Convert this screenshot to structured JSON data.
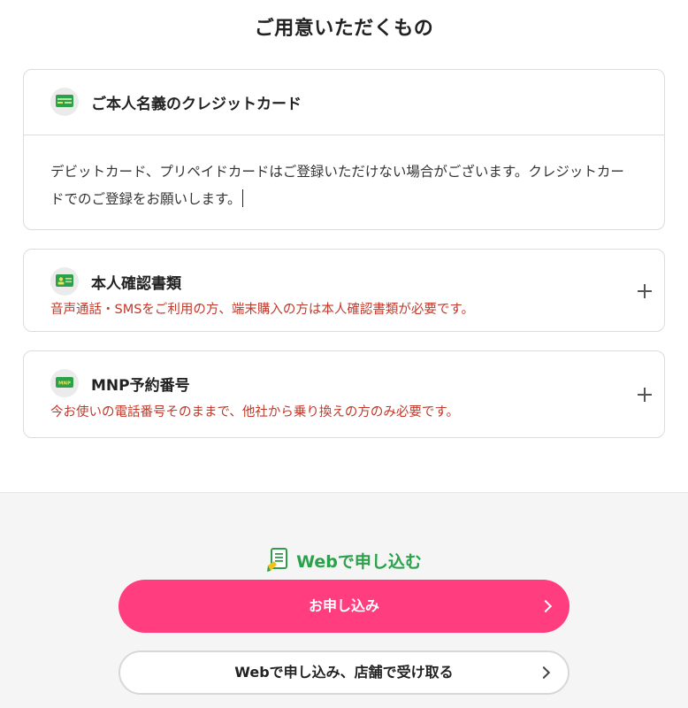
{
  "page": {
    "title": "ご用意いただくもの"
  },
  "items": {
    "credit": {
      "title": "ご本人名義のクレジットカード",
      "body": "デビットカード、プリペイドカードはご登録いただけない場合がございます。クレジットカードでのご登録をお願いします。",
      "icon": "credit-card-icon"
    },
    "id_doc": {
      "title": "本人確認書類",
      "note": "音声通話・SMSをご利用の方、端末購入の方は本人確認書類が必要です。",
      "icon": "id-card-icon"
    },
    "mnp": {
      "title": "MNP予約番号",
      "note": "今お使いの電話番号そのままで、他社から乗り換えの方のみ必要です。",
      "icon": "mnp-card-icon",
      "icon_text": "MNP"
    }
  },
  "footer": {
    "heading": "Webで申し込む",
    "primary_button": "お申し込み",
    "secondary_button": "Webで申し込み、店舗で受け取る"
  },
  "colors": {
    "accent_green": "#2aa14a",
    "primary_pink": "#ff3d7f",
    "note_red": "#c0392b"
  }
}
